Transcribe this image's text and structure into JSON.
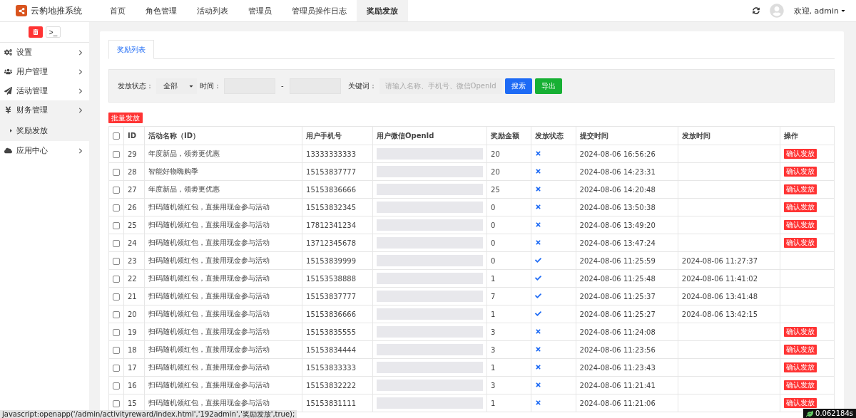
{
  "app": {
    "title": "云豹地推系统"
  },
  "nav": [
    {
      "label": "首页",
      "selected": false
    },
    {
      "label": "角色管理",
      "selected": false
    },
    {
      "label": "活动列表",
      "selected": false
    },
    {
      "label": "管理员",
      "selected": false
    },
    {
      "label": "管理员操作日志",
      "selected": false
    },
    {
      "label": "奖励发放",
      "selected": true
    }
  ],
  "user": {
    "greeting": "欢迎, admin"
  },
  "sidebar": {
    "items": [
      {
        "label": "设置",
        "expanded": false
      },
      {
        "label": "用户管理",
        "expanded": false
      },
      {
        "label": "活动管理",
        "expanded": false
      },
      {
        "label": "财务管理",
        "expanded": true,
        "children": [
          {
            "label": "奖励发放",
            "selected": true
          }
        ]
      },
      {
        "label": "应用中心",
        "expanded": false
      }
    ],
    "toolbar": {
      "terminal": ">_"
    }
  },
  "tabs": [
    {
      "label": "奖励列表",
      "selected": true
    }
  ],
  "filters": {
    "status_label": "发放状态：",
    "status_value": "全部",
    "time_label": "时间：",
    "time_separator": "-",
    "keyword_label": "关键词：",
    "keyword_placeholder": "请输入名称、手机号、微信OpenId",
    "search": "搜索",
    "export": "导出"
  },
  "batch_button": "批量发放",
  "table": {
    "select_all_checked": false,
    "columns": [
      "ID",
      "活动名称（ID）",
      "用户手机号",
      "用户微信OpenId",
      "奖励金额",
      "发放状态",
      "提交时间",
      "发放时间",
      "操作"
    ],
    "rows": [
      {
        "checked": false,
        "id": "29",
        "activity": "年度新品，领劵更优惠",
        "phone": "13333333333",
        "amount": "20",
        "issued": false,
        "submitted": "2024-08-06 16:56:26",
        "issued_at": "",
        "action": "确认发放"
      },
      {
        "checked": false,
        "id": "28",
        "activity": "智能好物嗨购季",
        "phone": "15153837777",
        "amount": "20",
        "issued": false,
        "submitted": "2024-08-06 14:23:31",
        "issued_at": "",
        "action": "确认发放"
      },
      {
        "checked": false,
        "id": "27",
        "activity": "年度新品，领劵更优惠",
        "phone": "15153836666",
        "amount": "25",
        "issued": false,
        "submitted": "2024-08-06 14:20:48",
        "issued_at": "",
        "action": "确认发放"
      },
      {
        "checked": false,
        "id": "26",
        "activity": "扫码随机领红包，直接用现金参与活动",
        "phone": "15153832345",
        "amount": "0",
        "issued": false,
        "submitted": "2024-08-06 13:50:38",
        "issued_at": "",
        "action": "确认发放"
      },
      {
        "checked": false,
        "id": "25",
        "activity": "扫码随机领红包，直接用现金参与活动",
        "phone": "17812341234",
        "amount": "0",
        "issued": false,
        "submitted": "2024-08-06 13:49:20",
        "issued_at": "",
        "action": "确认发放"
      },
      {
        "checked": false,
        "id": "24",
        "activity": "扫码随机领红包，直接用现金参与活动",
        "phone": "13712345678",
        "amount": "0",
        "issued": false,
        "submitted": "2024-08-06 13:47:24",
        "issued_at": "",
        "action": "确认发放"
      },
      {
        "checked": false,
        "id": "23",
        "activity": "扫码随机领红包，直接用现金参与活动",
        "phone": "15153839999",
        "amount": "0",
        "issued": true,
        "submitted": "2024-08-06 11:25:59",
        "issued_at": "2024-08-06 11:27:37",
        "action": ""
      },
      {
        "checked": false,
        "id": "22",
        "activity": "扫码随机领红包，直接用现金参与活动",
        "phone": "15153538888",
        "amount": "1",
        "issued": true,
        "submitted": "2024-08-06 11:25:48",
        "issued_at": "2024-08-06 11:41:02",
        "action": ""
      },
      {
        "checked": false,
        "id": "21",
        "activity": "扫码随机领红包，直接用现金参与活动",
        "phone": "15153837777",
        "amount": "7",
        "issued": true,
        "submitted": "2024-08-06 11:25:37",
        "issued_at": "2024-08-06 13:41:48",
        "action": ""
      },
      {
        "checked": false,
        "id": "20",
        "activity": "扫码随机领红包，直接用现金参与活动",
        "phone": "15153836666",
        "amount": "1",
        "issued": true,
        "submitted": "2024-08-06 11:25:27",
        "issued_at": "2024-08-06 13:42:15",
        "action": ""
      },
      {
        "checked": false,
        "id": "19",
        "activity": "扫码随机领红包，直接用现金参与活动",
        "phone": "15153835555",
        "amount": "3",
        "issued": false,
        "submitted": "2024-08-06 11:24:08",
        "issued_at": "",
        "action": "确认发放"
      },
      {
        "checked": false,
        "id": "18",
        "activity": "扫码随机领红包，直接用现金参与活动",
        "phone": "15153834444",
        "amount": "3",
        "issued": false,
        "submitted": "2024-08-06 11:23:56",
        "issued_at": "",
        "action": "确认发放"
      },
      {
        "checked": false,
        "id": "17",
        "activity": "扫码随机领红包，直接用现金参与活动",
        "phone": "15153833333",
        "amount": "1",
        "issued": false,
        "submitted": "2024-08-06 11:23:43",
        "issued_at": "",
        "action": "确认发放"
      },
      {
        "checked": false,
        "id": "16",
        "activity": "扫码随机领红包，直接用现金参与活动",
        "phone": "15153832222",
        "amount": "3",
        "issued": false,
        "submitted": "2024-08-06 11:21:41",
        "issued_at": "",
        "action": "确认发放"
      },
      {
        "checked": false,
        "id": "15",
        "activity": "扫码随机领红包，直接用现金参与活动",
        "phone": "15153831111",
        "amount": "1",
        "issued": false,
        "submitted": "2024-08-06 11:21:06",
        "issued_at": "",
        "action": "确认发放"
      }
    ]
  },
  "status_bar": {
    "link": "javascript:openapp('/admin/activityreward/index.html','192admin','奖励发放',true);",
    "timer": "0.062184s"
  }
}
